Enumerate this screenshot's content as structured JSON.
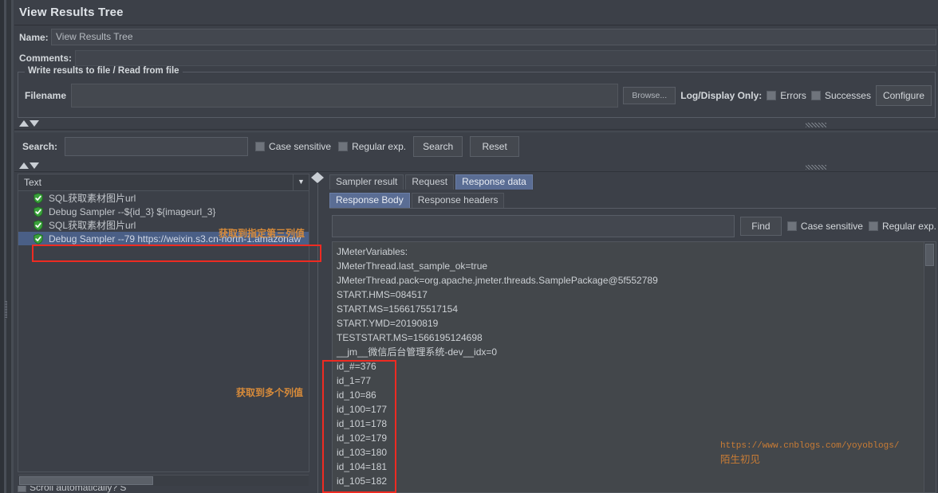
{
  "window": {
    "title": "View Results Tree"
  },
  "name_row": {
    "label": "Name:",
    "value": "View Results Tree"
  },
  "comments_row": {
    "label": "Comments:",
    "value": ""
  },
  "file_group": {
    "legend": "Write results to file / Read from file",
    "filename_label": "Filename",
    "filename_value": "",
    "browse_label": "Browse...",
    "log_display_label": "Log/Display Only:",
    "errors_label": "Errors",
    "successes_label": "Successes",
    "configure_label": "Configure"
  },
  "search_bar": {
    "label": "Search:",
    "value": "",
    "case_sensitive_label": "Case sensitive",
    "regular_exp_label": "Regular exp.",
    "search_label": "Search",
    "reset_label": "Reset"
  },
  "tree": {
    "header_label": "Text",
    "rows": [
      {
        "label": "SQL获取素材图片url",
        "selected": false
      },
      {
        "label": "Debug Sampler --${id_3} ${imageurl_3}",
        "selected": false
      },
      {
        "label": "SQL获取素材图片url",
        "selected": false
      },
      {
        "label": "Debug Sampler --79 https://weixin.s3.cn-north-1.amazonaw",
        "selected": true
      }
    ]
  },
  "result_tabs": {
    "outer": [
      {
        "label": "Sampler result",
        "active": false
      },
      {
        "label": "Request",
        "active": false
      },
      {
        "label": "Response data",
        "active": true
      }
    ],
    "inner": [
      {
        "label": "Response Body",
        "active": true
      },
      {
        "label": "Response headers",
        "active": false
      }
    ]
  },
  "find_bar": {
    "value": "",
    "find_label": "Find",
    "case_sensitive_label": "Case sensitive",
    "regular_exp_label": "Regular exp."
  },
  "response_body": {
    "text": "JMeterVariables:\nJMeterThread.last_sample_ok=true\nJMeterThread.pack=org.apache.jmeter.threads.SamplePackage@5f552789\nSTART.HMS=084517\nSTART.MS=1566175517154\nSTART.YMD=20190819\nTESTSTART.MS=1566195124698\n__jm__微信后台管理系统-dev__idx=0\nid_#=376\nid_1=77\nid_10=86\nid_100=177\nid_101=178\nid_102=179\nid_103=180\nid_104=181\nid_105=182"
  },
  "annotations": {
    "third_column": "获取到指定第三列值",
    "multiple_values": "获取到多个列值"
  },
  "watermark": {
    "url": "https://www.cnblogs.com/yoyoblogs/",
    "author": "陌生初见"
  },
  "bottom_row": {
    "label": "Scroll automatically? S"
  },
  "colors": {
    "background": "#3c4048",
    "accent_tab": "#5a6d94",
    "selection": "#4a5f86",
    "annotation": "#d88b3a",
    "redbox": "#ee2b22",
    "shield_green": "#39a03a"
  }
}
